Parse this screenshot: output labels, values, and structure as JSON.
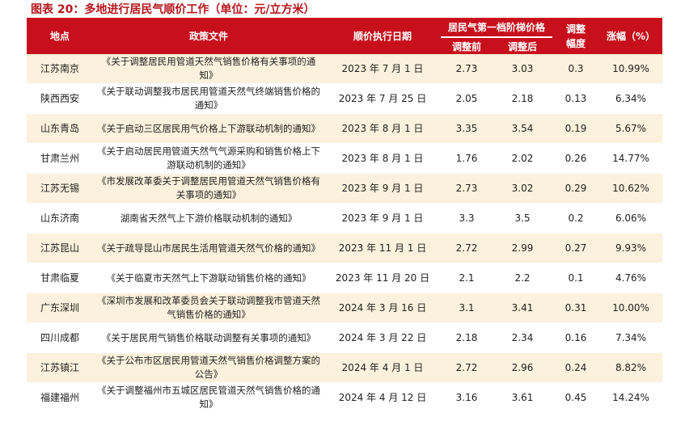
{
  "title": "图表 20：多地进行居民气顺价工作（单位：元/立方米）",
  "headers": {
    "region": "地点",
    "policy": "政策文件",
    "date": "顺价执行日期",
    "tier": "居民气第一档阶梯价格",
    "before": "调整前",
    "after": "调整后",
    "change": "调整幅度",
    "pct": "涨幅（%）"
  },
  "rows": [
    {
      "region": "江苏南京",
      "policy": "《关于调整居民用管道天然气销售价格有关事项的通知》",
      "date": "2023 年 7 月 1 日",
      "before": "2.73",
      "after": "3.03",
      "change": "0.3",
      "pct": "10.99%"
    },
    {
      "region": "陕西西安",
      "policy": "《关于联动调整我市居民用管道天然气终端销售价格的通知》",
      "date": "2023 年 7 月 25 日",
      "before": "2.05",
      "after": "2.18",
      "change": "0.13",
      "pct": "6.34%"
    },
    {
      "region": "山东青岛",
      "policy": "《关于启动三区居民用气价格上下游联动机制的通知》",
      "date": "2023 年 8 月 1 日",
      "before": "3.35",
      "after": "3.54",
      "change": "0.19",
      "pct": "5.67%"
    },
    {
      "region": "甘肃兰州",
      "policy": "《关于启动居民用管道天然气气源采购和销售价格上下游联动机制的通知》",
      "date": "2023 年 8 月 1 日",
      "before": "1.76",
      "after": "2.02",
      "change": "0.26",
      "pct": "14.77%"
    },
    {
      "region": "江苏无锡",
      "policy": "《市发展改革委关于调整居民用管道天然气销售价格有关事项的通知》",
      "date": "2023 年 9 月 1 日",
      "before": "2.73",
      "after": "3.02",
      "change": "0.29",
      "pct": "10.62%"
    },
    {
      "region": "山东济南",
      "policy": "湖南省天然气上下游价格联动机制的通知》",
      "date": "2023 年 9 月 1 日",
      "before": "3.3",
      "after": "3.5",
      "change": "0.2",
      "pct": "6.06%"
    },
    {
      "region": "江苏昆山",
      "policy": "《关于疏导昆山市居民生活用管道天然气价格的通知》",
      "date": "2023 年 11 月 1 日",
      "before": "2.72",
      "after": "2.99",
      "change": "0.27",
      "pct": "9.93%"
    },
    {
      "region": "甘肃临夏",
      "policy": "《关于临夏市天然气上下游联动销售价格的通知》",
      "date": "2023 年 11 月 20 日",
      "before": "2.1",
      "after": "2.2",
      "change": "0.1",
      "pct": "4.76%"
    },
    {
      "region": "广东深圳",
      "policy": "《深圳市发展和改革委员会关于联动调整我市管道天然气销售价格的通知》",
      "date": "2024 年 3 月 16 日",
      "before": "3.1",
      "after": "3.41",
      "change": "0.31",
      "pct": "10.00%"
    },
    {
      "region": "四川成都",
      "policy": "《关于居民用气销售价格联动调整有关事项的通知》",
      "date": "2024 年 3 月 22 日",
      "before": "2.18",
      "after": "2.34",
      "change": "0.16",
      "pct": "7.34%"
    },
    {
      "region": "江苏镇江",
      "policy": "《关于公布市区居民用管道天然气销售价格调整方案的公告》",
      "date": "2024 年 4 月 1 日",
      "before": "2.72",
      "after": "2.96",
      "change": "0.24",
      "pct": "8.82%"
    },
    {
      "region": "福建福州",
      "policy": "《关于调整福州市五城区居民管道天然气销售价格的通知》",
      "date": "2024 年 4 月 12 日",
      "before": "3.16",
      "after": "3.61",
      "change": "0.45",
      "pct": "14.24%"
    }
  ]
}
